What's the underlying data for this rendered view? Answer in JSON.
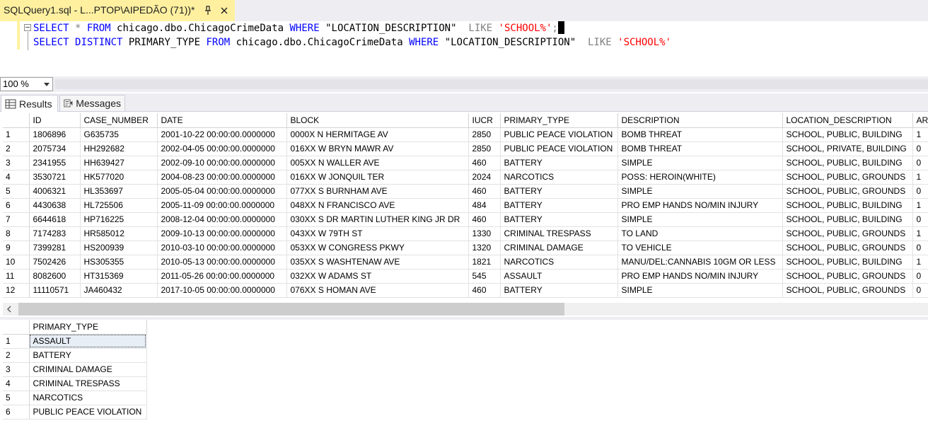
{
  "tab": {
    "title": "SQLQuery1.sql - L...PTOP\\AIPEDÃO (71))*"
  },
  "editor": {
    "line1": {
      "kw1": "SELECT",
      "op1": "*",
      "kw2": "FROM",
      "table": "chicago.dbo.ChicagoCrimeData",
      "kw3": "WHERE",
      "col": "\"LOCATION_DESCRIPTION\"",
      "op2": "LIKE",
      "str": "'SCHOOL%'",
      "semi": ";"
    },
    "line2": {
      "kw1": "SELECT",
      "kw2": "DISTINCT",
      "col1": "PRIMARY_TYPE",
      "kw3": "FROM",
      "table": "chicago.dbo.ChicagoCrimeData",
      "kw4": "WHERE",
      "col": "\"LOCATION_DESCRIPTION\"",
      "op": "LIKE",
      "str": "'SCHOOL%'"
    }
  },
  "zoom": {
    "value": "100 %"
  },
  "result_tabs": {
    "results": "Results",
    "messages": "Messages"
  },
  "grid1": {
    "columns": [
      "ID",
      "CASE_NUMBER",
      "DATE",
      "BLOCK",
      "IUCR",
      "PRIMARY_TYPE",
      "DESCRIPTION",
      "LOCATION_DESCRIPTION",
      "ARI"
    ],
    "rows": [
      [
        "1",
        "1806896",
        "G635735",
        "2001-10-22 00:00:00.0000000",
        "0000X N HERMITAGE AV",
        "2850",
        "PUBLIC PEACE VIOLATION",
        "BOMB THREAT",
        "SCHOOL, PUBLIC, BUILDING",
        "1"
      ],
      [
        "2",
        "2075734",
        "HH292682",
        "2002-04-05 00:00:00.0000000",
        "016XX W BRYN MAWR AV",
        "2850",
        "PUBLIC PEACE VIOLATION",
        "BOMB THREAT",
        "SCHOOL, PRIVATE, BUILDING",
        "0"
      ],
      [
        "3",
        "2341955",
        "HH639427",
        "2002-09-10 00:00:00.0000000",
        "005XX N WALLER AVE",
        "460",
        "BATTERY",
        "SIMPLE",
        "SCHOOL, PUBLIC, BUILDING",
        "0"
      ],
      [
        "4",
        "3530721",
        "HK577020",
        "2004-08-23 00:00:00.0000000",
        "016XX W JONQUIL TER",
        "2024",
        "NARCOTICS",
        "POSS: HEROIN(WHITE)",
        "SCHOOL, PUBLIC, GROUNDS",
        "1"
      ],
      [
        "5",
        "4006321",
        "HL353697",
        "2005-05-04 00:00:00.0000000",
        "077XX S BURNHAM AVE",
        "460",
        "BATTERY",
        "SIMPLE",
        "SCHOOL, PUBLIC, GROUNDS",
        "0"
      ],
      [
        "6",
        "4430638",
        "HL725506",
        "2005-11-09 00:00:00.0000000",
        "048XX N FRANCISCO AVE",
        "484",
        "BATTERY",
        "PRO EMP HANDS NO/MIN INJURY",
        "SCHOOL, PUBLIC, BUILDING",
        "1"
      ],
      [
        "7",
        "6644618",
        "HP716225",
        "2008-12-04 00:00:00.0000000",
        "030XX S DR MARTIN LUTHER KING JR DR",
        "460",
        "BATTERY",
        "SIMPLE",
        "SCHOOL, PUBLIC, BUILDING",
        "0"
      ],
      [
        "8",
        "7174283",
        "HR585012",
        "2009-10-13 00:00:00.0000000",
        "043XX W 79TH ST",
        "1330",
        "CRIMINAL TRESPASS",
        "TO LAND",
        "SCHOOL, PUBLIC, GROUNDS",
        "1"
      ],
      [
        "9",
        "7399281",
        "HS200939",
        "2010-03-10 00:00:00.0000000",
        "053XX W CONGRESS PKWY",
        "1320",
        "CRIMINAL DAMAGE",
        "TO VEHICLE",
        "SCHOOL, PUBLIC, GROUNDS",
        "0"
      ],
      [
        "10",
        "7502426",
        "HS305355",
        "2010-05-13 00:00:00.0000000",
        "035XX S WASHTENAW AVE",
        "1821",
        "NARCOTICS",
        "MANU/DEL:CANNABIS 10GM OR LESS",
        "SCHOOL, PUBLIC, BUILDING",
        "1"
      ],
      [
        "11",
        "8082600",
        "HT315369",
        "2011-05-26 00:00:00.0000000",
        "032XX W ADAMS ST",
        "545",
        "ASSAULT",
        "PRO EMP HANDS NO/MIN INJURY",
        "SCHOOL, PUBLIC, GROUNDS",
        "0"
      ],
      [
        "12",
        "11110571",
        "JA460432",
        "2017-10-05 00:00:00.0000000",
        "076XX S HOMAN AVE",
        "460",
        "BATTERY",
        "SIMPLE",
        "SCHOOL, PUBLIC, GROUNDS",
        "0"
      ]
    ]
  },
  "grid2": {
    "columns": [
      "PRIMARY_TYPE"
    ],
    "rows": [
      [
        "1",
        "ASSAULT"
      ],
      [
        "2",
        "BATTERY"
      ],
      [
        "3",
        "CRIMINAL DAMAGE"
      ],
      [
        "4",
        "CRIMINAL TRESPASS"
      ],
      [
        "5",
        "NARCOTICS"
      ],
      [
        "6",
        "PUBLIC PEACE VIOLATION"
      ]
    ]
  }
}
